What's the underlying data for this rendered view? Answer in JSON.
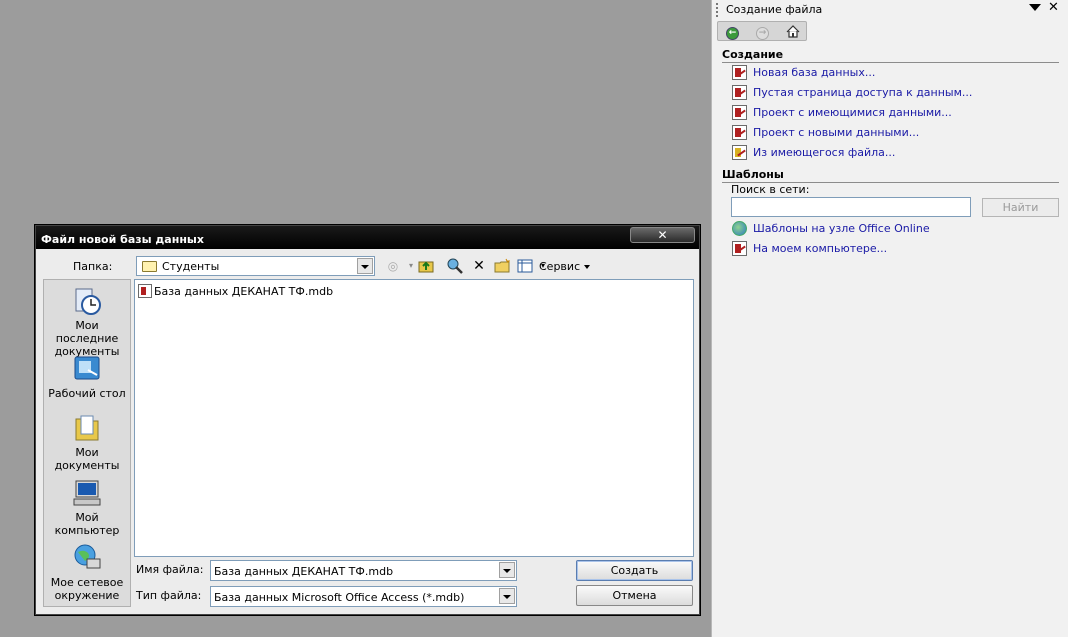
{
  "task_pane": {
    "title": "Создание файла",
    "section_create": "Создание",
    "create_links": [
      {
        "label": "Новая база данных...",
        "icon": "new-db-icon"
      },
      {
        "label": "Пустая страница доступа к данным...",
        "icon": "data-access-page-icon"
      },
      {
        "label": "Проект с имеющимися данными...",
        "icon": "project-existing-data-icon"
      },
      {
        "label": "Проект с новыми данными...",
        "icon": "project-new-data-icon"
      },
      {
        "label": "Из имеющегося файла...",
        "icon": "existing-file-icon"
      }
    ],
    "section_templates": "Шаблоны",
    "search_label": "Поиск в сети:",
    "search_value": "",
    "search_button": "Найти",
    "template_links": [
      {
        "label": "Шаблоны на узле Office Online",
        "icon": "office-online-icon"
      },
      {
        "label": "На моем компьютере...",
        "icon": "my-computer-template-icon"
      }
    ]
  },
  "dialog": {
    "title": "Файл новой базы данных",
    "close_symbol": "✕",
    "folder_label": "Папка:",
    "folder_value": "Студенты",
    "tools_menu": "Сервис",
    "places": [
      {
        "label": "Мои последние документы",
        "icon": "recent-documents-icon"
      },
      {
        "label": "Рабочий стол",
        "icon": "desktop-icon"
      },
      {
        "label": "Мои документы",
        "icon": "my-documents-icon"
      },
      {
        "label": "Мой компьютер",
        "icon": "my-computer-icon"
      },
      {
        "label": "Мое сетевое окружение",
        "icon": "network-places-icon"
      }
    ],
    "files": [
      {
        "name": "База данных ДЕКАНАТ ТФ.mdb",
        "icon": "mdb-file-icon"
      }
    ],
    "filename_label": "Имя файла:",
    "filename_value": "База данных ДЕКАНАТ ТФ.mdb",
    "filetype_label": "Тип файла:",
    "filetype_value": "База данных Microsoft Office Access (*.mdb)",
    "create_button": "Создать",
    "cancel_button": "Отмена"
  },
  "colors": {
    "desktop": "#9c9c9c",
    "link": "#1a1aa6",
    "titlebar": "#000000"
  }
}
